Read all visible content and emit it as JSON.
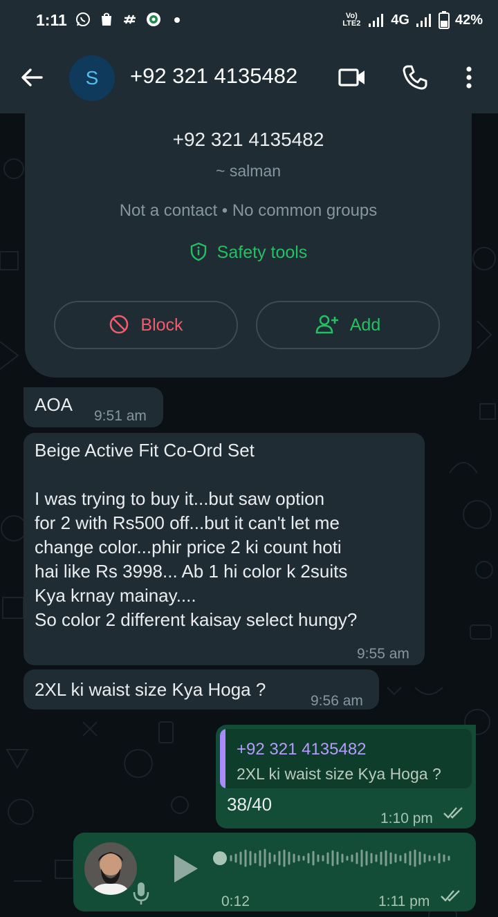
{
  "status_bar": {
    "time": "1:11",
    "network_label": "Vo) LTE2",
    "network_type": "4G",
    "battery": "42%",
    "icons": [
      "whatsapp-icon",
      "shop-icon",
      "hashtag-app-icon",
      "badge-app-icon",
      "dot-icon",
      "signal-icon",
      "signal-icon",
      "battery-icon"
    ]
  },
  "header": {
    "avatar_letter": "S",
    "title": "+92 321 4135482",
    "icons": [
      "back-arrow-icon",
      "video-call-icon",
      "phone-icon",
      "more-vert-icon"
    ]
  },
  "contact_card": {
    "number": "+92 321 4135482",
    "alias": "~ salman",
    "info": "Not a contact • No common groups",
    "safety_label": "Safety tools",
    "block_label": "Block",
    "add_label": "Add"
  },
  "messages": [
    {
      "direction": "in",
      "text": "AOA",
      "time": "9:51 am"
    },
    {
      "direction": "in",
      "text": "Beige Active Fit Co-Ord Set\n\nI was trying to buy it...but saw option\nfor 2 with Rs500 off...but it can't let me\nchange color...phir price 2 ki count hoti\nhai like Rs 3998... Ab 1 hi color k 2suits\nKya krnay mainay....\nSo color 2 different kaisay select hungy?",
      "time": "9:55 am"
    },
    {
      "direction": "in",
      "text": "2XL ki waist size Kya Hoga ?",
      "time": "9:56 am"
    },
    {
      "direction": "out",
      "quote_name": "+92 321 4135482",
      "quote_text": "2XL ki waist size Kya Hoga ?",
      "text": "38/40",
      "time": "1:10 pm",
      "status": "read"
    },
    {
      "direction": "out",
      "type": "voice",
      "duration": "0:12",
      "time": "1:11 pm",
      "status": "read",
      "progress": 0
    }
  ],
  "colors": {
    "header_bg": "#1f2c33",
    "chat_bg": "#0b1014",
    "incoming": "#1f2c33",
    "outgoing": "#144d37",
    "accent_green": "#21c063",
    "danger": "#f15c6d"
  }
}
